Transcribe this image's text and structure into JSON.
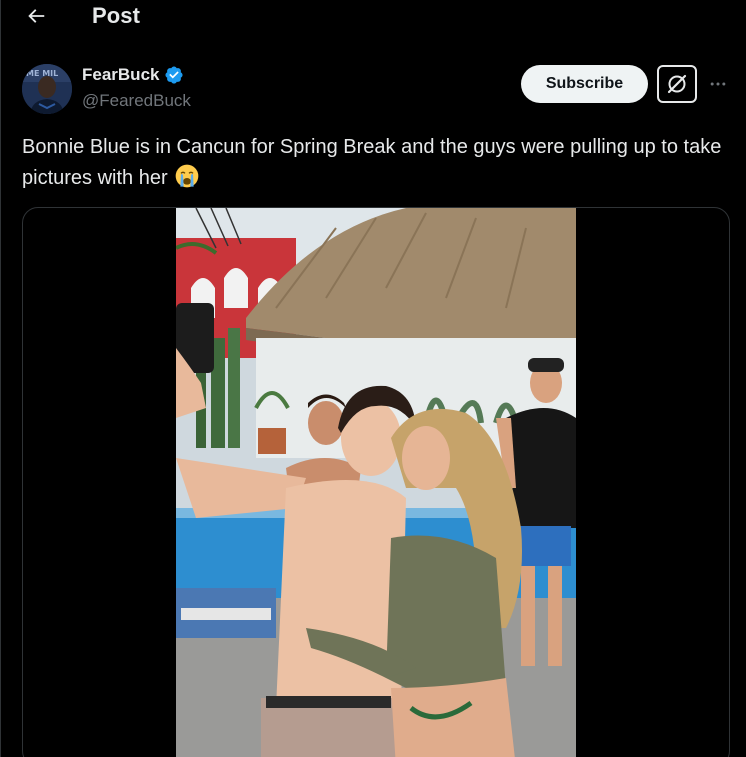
{
  "header": {
    "back_icon": "arrow-left-icon",
    "title": "Post"
  },
  "author": {
    "name": "FearBuck",
    "handle": "@FearedBuck",
    "verified": true,
    "verified_color": "#1d9bf0"
  },
  "actions": {
    "subscribe_label": "Subscribe",
    "grok_icon": "grok-icon",
    "more_icon": "more-horizontal-icon"
  },
  "post": {
    "text": "Bonnie Blue is in Cancun for Spring Break and the guys were pulling up to take pictures with her",
    "emoji": "loudly-crying-face"
  },
  "media": {
    "type": "video"
  },
  "colors": {
    "background": "#000000",
    "text": "#e7e9ea",
    "secondary_text": "#71767b",
    "border": "#2f3336"
  }
}
